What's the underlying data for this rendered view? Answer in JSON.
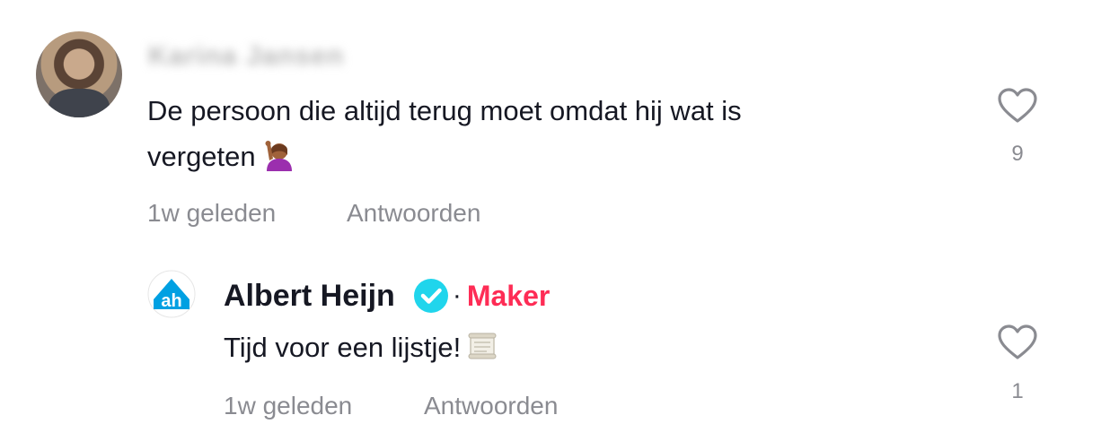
{
  "comments": [
    {
      "username": "Karina Jansen",
      "text": "De persoon die altijd terug moet omdat hij wat is",
      "text_line2": "vergeten",
      "emoji": "raising-hand-emoji",
      "time": "1w geleden",
      "reply_label": "Antwoorden",
      "likes": "9"
    },
    {
      "author": "Albert Heijn",
      "verified": true,
      "separator": "·",
      "badge": "Maker",
      "text": "Tijd voor een lijstje!",
      "emoji": "scroll-emoji",
      "time": "1w geleden",
      "reply_label": "Antwoorden",
      "likes": "1"
    }
  ],
  "colors": {
    "text": "#161823",
    "muted": "#8a8b91",
    "maker": "#fe2c55",
    "verified": "#20d5ec",
    "ah_blue": "#00a0e2"
  }
}
